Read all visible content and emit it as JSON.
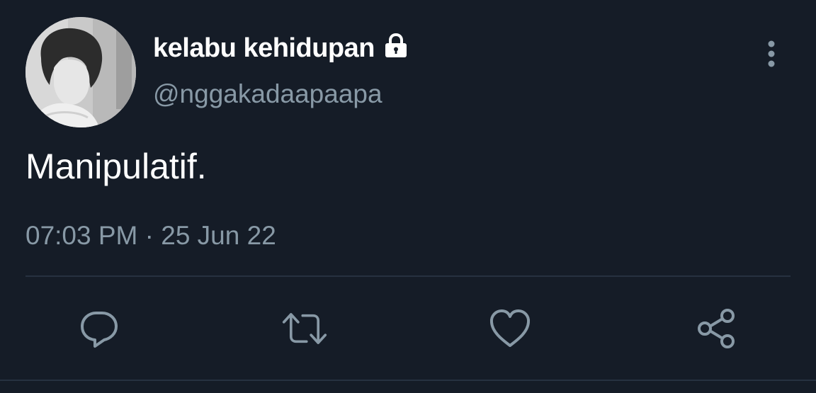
{
  "tweet": {
    "display_name": "kelabu kehidupan",
    "handle": "@nggakadaapaapa",
    "text": "Manipulatif.",
    "timestamp": "07:03 PM · 25 Jun 22",
    "protected": true
  },
  "icons": {
    "lock": "lock-icon",
    "more": "more-vertical-icon",
    "reply": "reply-icon",
    "retweet": "retweet-icon",
    "like": "like-icon",
    "share": "share-icon"
  },
  "colors": {
    "background": "#151c27",
    "primary_text": "#ffffff",
    "secondary_text": "#8899a6",
    "divider": "#263140",
    "icon": "#8899a6"
  }
}
